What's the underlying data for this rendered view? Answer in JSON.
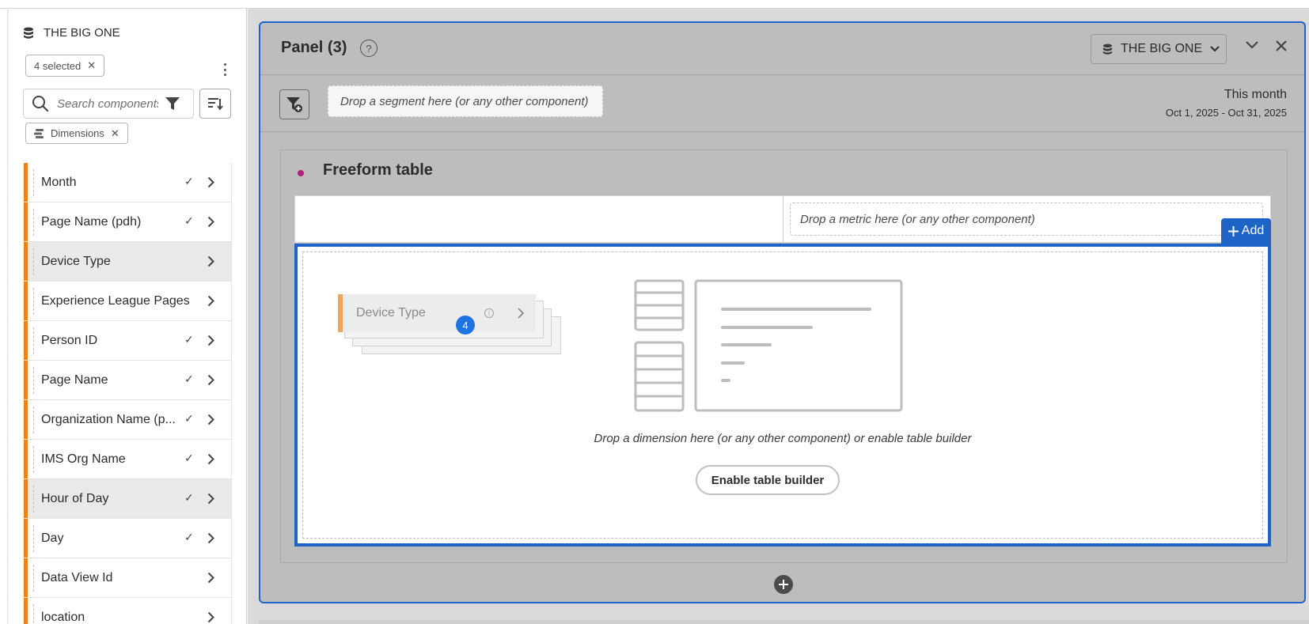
{
  "rail": {
    "datasource": "THE BIG ONE",
    "selected_chip": "4 selected",
    "search_placeholder": "Search components",
    "filter_chip": "Dimensions",
    "items": [
      {
        "label": "Month",
        "checked": true,
        "highlighted": false
      },
      {
        "label": "Page Name (pdh)",
        "checked": true,
        "highlighted": false
      },
      {
        "label": "Device Type",
        "checked": false,
        "highlighted": true
      },
      {
        "label": "Experience League Pages",
        "checked": false,
        "highlighted": false
      },
      {
        "label": "Person ID",
        "checked": true,
        "highlighted": false
      },
      {
        "label": "Page Name",
        "checked": true,
        "highlighted": false
      },
      {
        "label": "Organization Name (p...",
        "checked": true,
        "highlighted": false
      },
      {
        "label": "IMS Org Name",
        "checked": true,
        "highlighted": false
      },
      {
        "label": "Hour of Day",
        "checked": true,
        "highlighted": true
      },
      {
        "label": "Day",
        "checked": true,
        "highlighted": false
      },
      {
        "label": "Data View Id",
        "checked": false,
        "highlighted": false
      },
      {
        "label": "location",
        "checked": false,
        "highlighted": false
      }
    ],
    "check_glyph": "✓",
    "close_glyph": "✕"
  },
  "panel": {
    "title": "Panel (3)",
    "help": "?",
    "datasource_picker": "THE BIG ONE",
    "segment_drop": "Drop a segment here (or any other component)",
    "date_title": "This month",
    "date_range": "Oct 1, 2025 - Oct 31, 2025"
  },
  "freeform": {
    "title": "Freeform table",
    "metric_drop": "Drop a metric here (or any other component)",
    "add_label": "Add",
    "drag_item": "Device Type",
    "drag_count": "4",
    "dimension_drop": "Drop a dimension here (or any other component) or enable table builder",
    "enable_button": "Enable table builder"
  },
  "colors": {
    "accent": "#1e64c8",
    "dimension_bar": "#e68619",
    "viz_dot": "#b1207a"
  }
}
